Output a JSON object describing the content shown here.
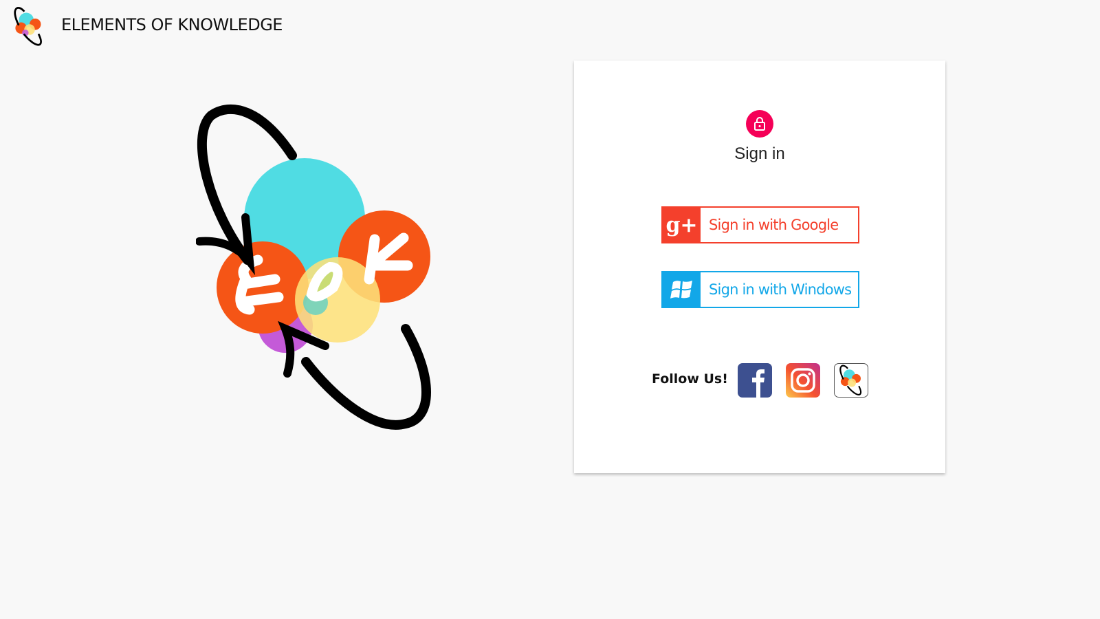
{
  "header": {
    "brand": "ELEMENTS OF KNOWLEDGE",
    "logo_icon": "eok-logo-icon"
  },
  "hero": {
    "logo_text": "EOK"
  },
  "signin": {
    "title": "Sign in",
    "google_label": "Sign in with Google",
    "windows_label": "Sign in with Windows",
    "follow_label": "Follow Us!",
    "colors": {
      "lock": "#f50057",
      "google": "#f4402c",
      "windows": "#12a7e8",
      "facebook": "#3d5090"
    }
  }
}
